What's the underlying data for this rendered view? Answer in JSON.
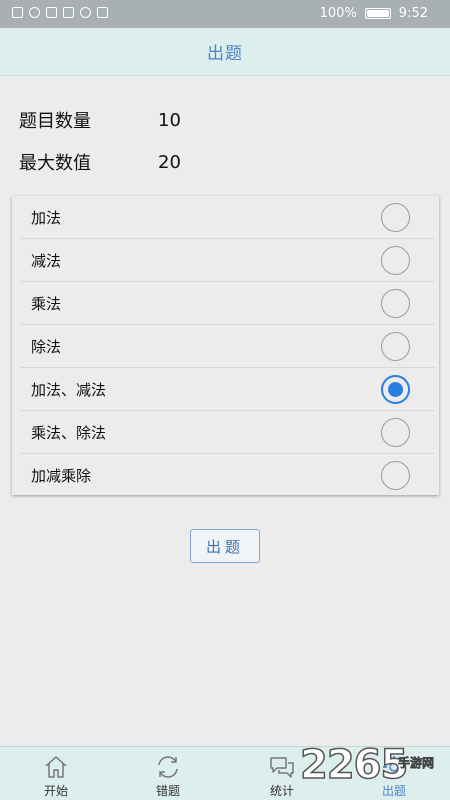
{
  "status_bar": {
    "battery": "100%",
    "time": "9:52"
  },
  "header": {
    "title": "出题"
  },
  "settings": {
    "question_count_label": "题目数量",
    "question_count_value": "10",
    "max_value_label": "最大数值",
    "max_value_value": "20"
  },
  "options": [
    {
      "label": "加法",
      "selected": false
    },
    {
      "label": "减法",
      "selected": false
    },
    {
      "label": "乘法",
      "selected": false
    },
    {
      "label": "除法",
      "selected": false
    },
    {
      "label": "加法、减法",
      "selected": true
    },
    {
      "label": "乘法、除法",
      "selected": false
    },
    {
      "label": "加减乘除",
      "selected": false
    }
  ],
  "generate_button_label": "出题",
  "bottom_nav": [
    {
      "label": "开始",
      "icon": "home-icon",
      "active": false
    },
    {
      "label": "错题",
      "icon": "refresh-icon",
      "active": false
    },
    {
      "label": "统计",
      "icon": "chat-icon",
      "active": false
    },
    {
      "label": "出题",
      "icon": "gear-icon",
      "active": true
    }
  ],
  "watermark": {
    "main": "2265",
    "sub": "手游网"
  },
  "colors": {
    "accent": "#2a7de1",
    "header_bg": "#dcefec",
    "title_text": "#4d83c9"
  }
}
